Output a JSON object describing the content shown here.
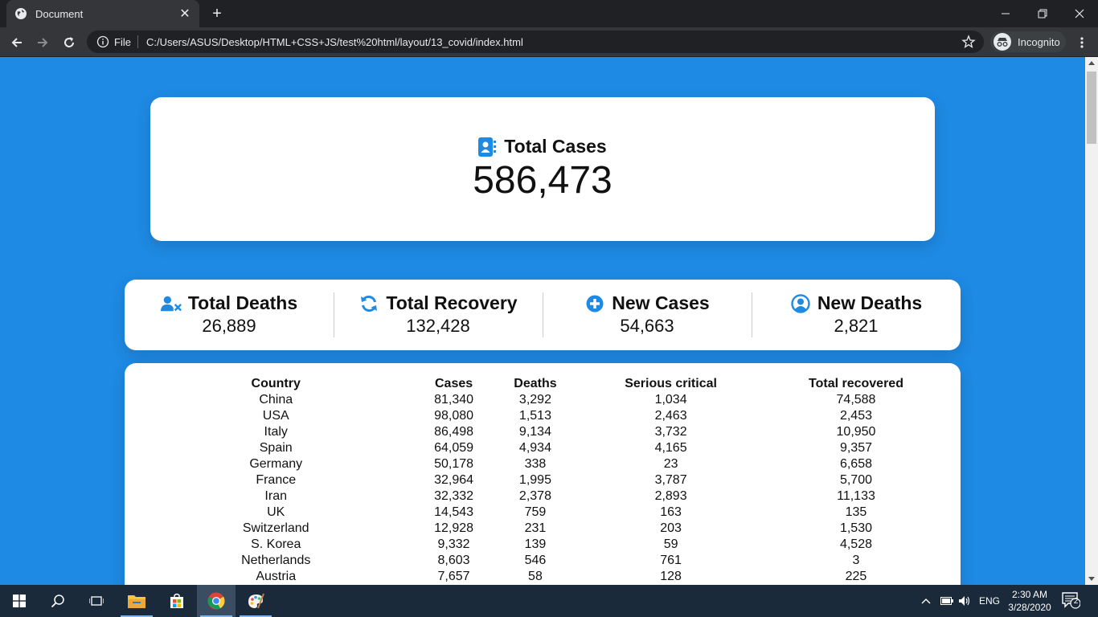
{
  "browser": {
    "tab_title": "Document",
    "omnibox_scheme": "File",
    "url": "C:/Users/ASUS/Desktop/HTML+CSS+JS/test%20html/layout/13_covid/index.html",
    "incognito_label": "Incognito"
  },
  "summary": {
    "title": "Total Cases",
    "value": "586,473"
  },
  "stats": [
    {
      "label": "Total Deaths",
      "value": "26,889",
      "icon": "user-times-icon"
    },
    {
      "label": "Total Recovery",
      "value": "132,428",
      "icon": "sync-icon"
    },
    {
      "label": "New Cases",
      "value": "54,663",
      "icon": "plus-circle-icon"
    },
    {
      "label": "New Deaths",
      "value": "2,821",
      "icon": "user-circle-icon"
    }
  ],
  "table": {
    "headers": [
      "Country",
      "Cases",
      "Deaths",
      "Serious critical",
      "Total recovered"
    ],
    "rows": [
      [
        "China",
        "81,340",
        "3,292",
        "1,034",
        "74,588"
      ],
      [
        "USA",
        "98,080",
        "1,513",
        "2,463",
        "2,453"
      ],
      [
        "Italy",
        "86,498",
        "9,134",
        "3,732",
        "10,950"
      ],
      [
        "Spain",
        "64,059",
        "4,934",
        "4,165",
        "9,357"
      ],
      [
        "Germany",
        "50,178",
        "338",
        "23",
        "6,658"
      ],
      [
        "France",
        "32,964",
        "1,995",
        "3,787",
        "5,700"
      ],
      [
        "Iran",
        "32,332",
        "2,378",
        "2,893",
        "11,133"
      ],
      [
        "UK",
        "14,543",
        "759",
        "163",
        "135"
      ],
      [
        "Switzerland",
        "12,928",
        "231",
        "203",
        "1,530"
      ],
      [
        "S. Korea",
        "9,332",
        "139",
        "59",
        "4,528"
      ],
      [
        "Netherlands",
        "8,603",
        "546",
        "761",
        "3"
      ],
      [
        "Austria",
        "7,657",
        "58",
        "128",
        "225"
      ]
    ]
  },
  "taskbar": {
    "language": "ENG",
    "time": "2:30 AM",
    "date": "3/28/2020",
    "notification_count": "2"
  },
  "colors": {
    "page_background": "#1e8ae4",
    "icon_blue": "#1e8ae4"
  }
}
